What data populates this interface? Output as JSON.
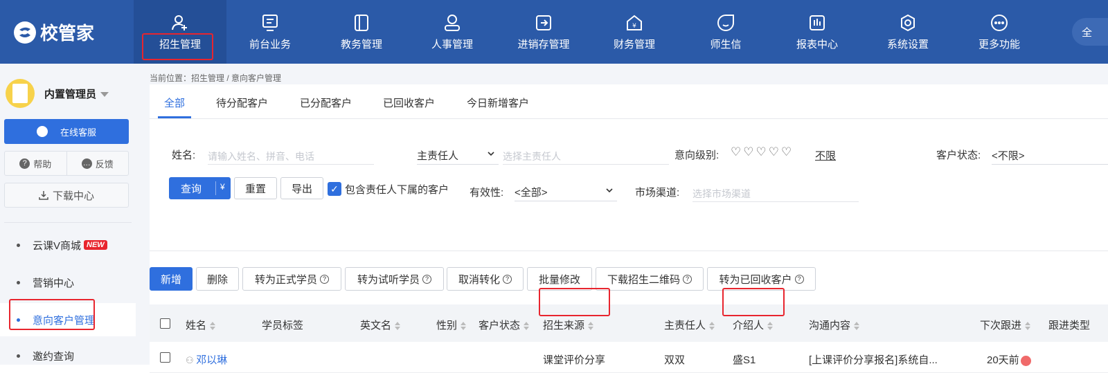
{
  "app": {
    "logo_text": "校管家"
  },
  "nav": {
    "items": [
      {
        "label": "招生管理",
        "icon": "user-add-icon"
      },
      {
        "label": "前台业务",
        "icon": "monitor-icon"
      },
      {
        "label": "教务管理",
        "icon": "book-icon"
      },
      {
        "label": "人事管理",
        "icon": "person-icon"
      },
      {
        "label": "进销存管理",
        "icon": "inout-icon"
      },
      {
        "label": "财务管理",
        "icon": "yen-house-icon"
      },
      {
        "label": "师生信",
        "icon": "chat-icon"
      },
      {
        "label": "报表中心",
        "icon": "report-icon"
      },
      {
        "label": "系统设置",
        "icon": "settings-icon"
      },
      {
        "label": "更多功能",
        "icon": "more-icon"
      }
    ],
    "cut_text": "全"
  },
  "sidebar": {
    "user_name": "内置管理员",
    "service_label": "在线客服",
    "help_label": "帮助",
    "feedback_label": "反馈",
    "download_label": "下载中心",
    "menu": [
      {
        "label": "云课V商城",
        "badge": "NEW"
      },
      {
        "label": "营销中心"
      },
      {
        "label": "意向客户管理"
      },
      {
        "label": "邀约查询"
      }
    ]
  },
  "breadcrumb": "当前位置：招生管理 / 意向客户管理",
  "tabs": [
    "全部",
    "待分配客户",
    "已分配客户",
    "已回收客户",
    "今日新增客户"
  ],
  "filters": {
    "name_label": "姓名:",
    "name_placeholder": "请输入姓名、拼音、电话",
    "owner_select": "主责任人",
    "owner_placeholder": "选择主责任人",
    "intent_label": "意向级别:",
    "intent_hearts": "♡♡♡♡♡",
    "intent_unlimited": "不限",
    "status_label": "客户状态:",
    "status_value": "<不限>",
    "query": "查询",
    "reset": "重置",
    "export": "导出",
    "include_sub": "包含责任人下属的客户",
    "validity_label": "有效性:",
    "validity_value": "<全部>",
    "channel_label": "市场渠道:",
    "channel_placeholder": "选择市场渠道"
  },
  "actions": [
    "新增",
    "删除",
    "转为正式学员",
    "转为试听学员",
    "取消转化",
    "批量修改",
    "下载招生二维码",
    "转为已回收客户"
  ],
  "table": {
    "columns": [
      "姓名",
      "学员标签",
      "英文名",
      "性别",
      "客户状态",
      "招生来源",
      "主责任人",
      "介绍人",
      "沟通内容",
      "下次跟进",
      "跟进类型"
    ],
    "rows": [
      {
        "name": "邓以琳",
        "source": "课堂评价分享",
        "owner": "双双",
        "referrer": "盛S1",
        "comm": "[上课评价分享报名]系统自...",
        "next": "20天前"
      }
    ]
  },
  "colors": {
    "topbar": "#2b5aa8",
    "accent": "#2f6fde",
    "highlight": "#e8252e"
  }
}
